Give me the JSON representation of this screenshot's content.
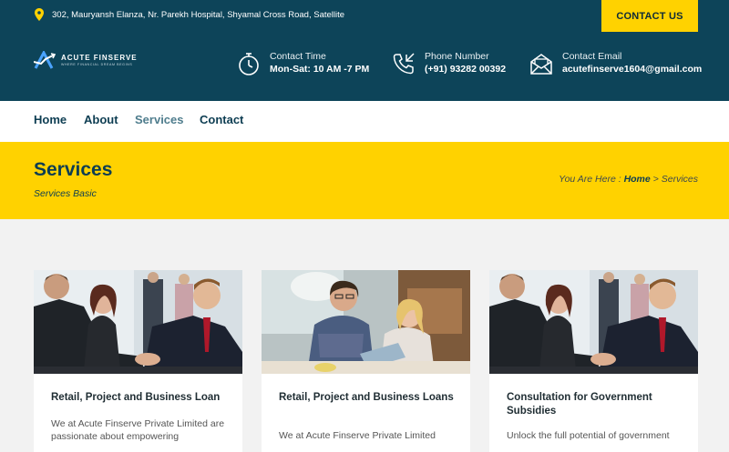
{
  "topbar": {
    "address": "302, Mauryansh Elanza, Nr. Parekh Hospital, Shyamal Cross Road, Satellite",
    "contact_button": "CONTACT US",
    "logo_name": "ACUTE FINSERVE",
    "logo_tagline": "WHERE FINANCIAL DREAM BEGINS",
    "contact_time_label": "Contact Time",
    "contact_time_value": "Mon-Sat: 10 AM -7 PM",
    "phone_label": "Phone Number",
    "phone_value": "(+91) 93282 00392",
    "email_label": "Contact Email",
    "email_value": "acutefinserve1604@gmail.com"
  },
  "nav": {
    "items": [
      "Home",
      "About",
      "Services",
      "Contact"
    ],
    "active": "Services"
  },
  "banner": {
    "title": "Services",
    "subtitle": "Services Basic",
    "crumb_prefix": "You Are Here :",
    "crumb_home": "Home",
    "crumb_sep": ">",
    "crumb_current": "Services"
  },
  "cards": [
    {
      "title": "Retail, Project and Business Loan",
      "text": "We at Acute Finserve Private Limited are passionate about empowering"
    },
    {
      "title": "Retail, Project and Business Loans",
      "text": "We at Acute Finserve Private Limited"
    },
    {
      "title": "Consultation for Government Subsidies",
      "text": "Unlock the full potential of government"
    }
  ],
  "colors": {
    "navy": "#0d4459",
    "yellow": "#ffd200",
    "background": "#f2f2f2"
  },
  "icons": [
    "location-pin-icon",
    "stopwatch-icon",
    "phone-icon",
    "envelope-icon"
  ]
}
